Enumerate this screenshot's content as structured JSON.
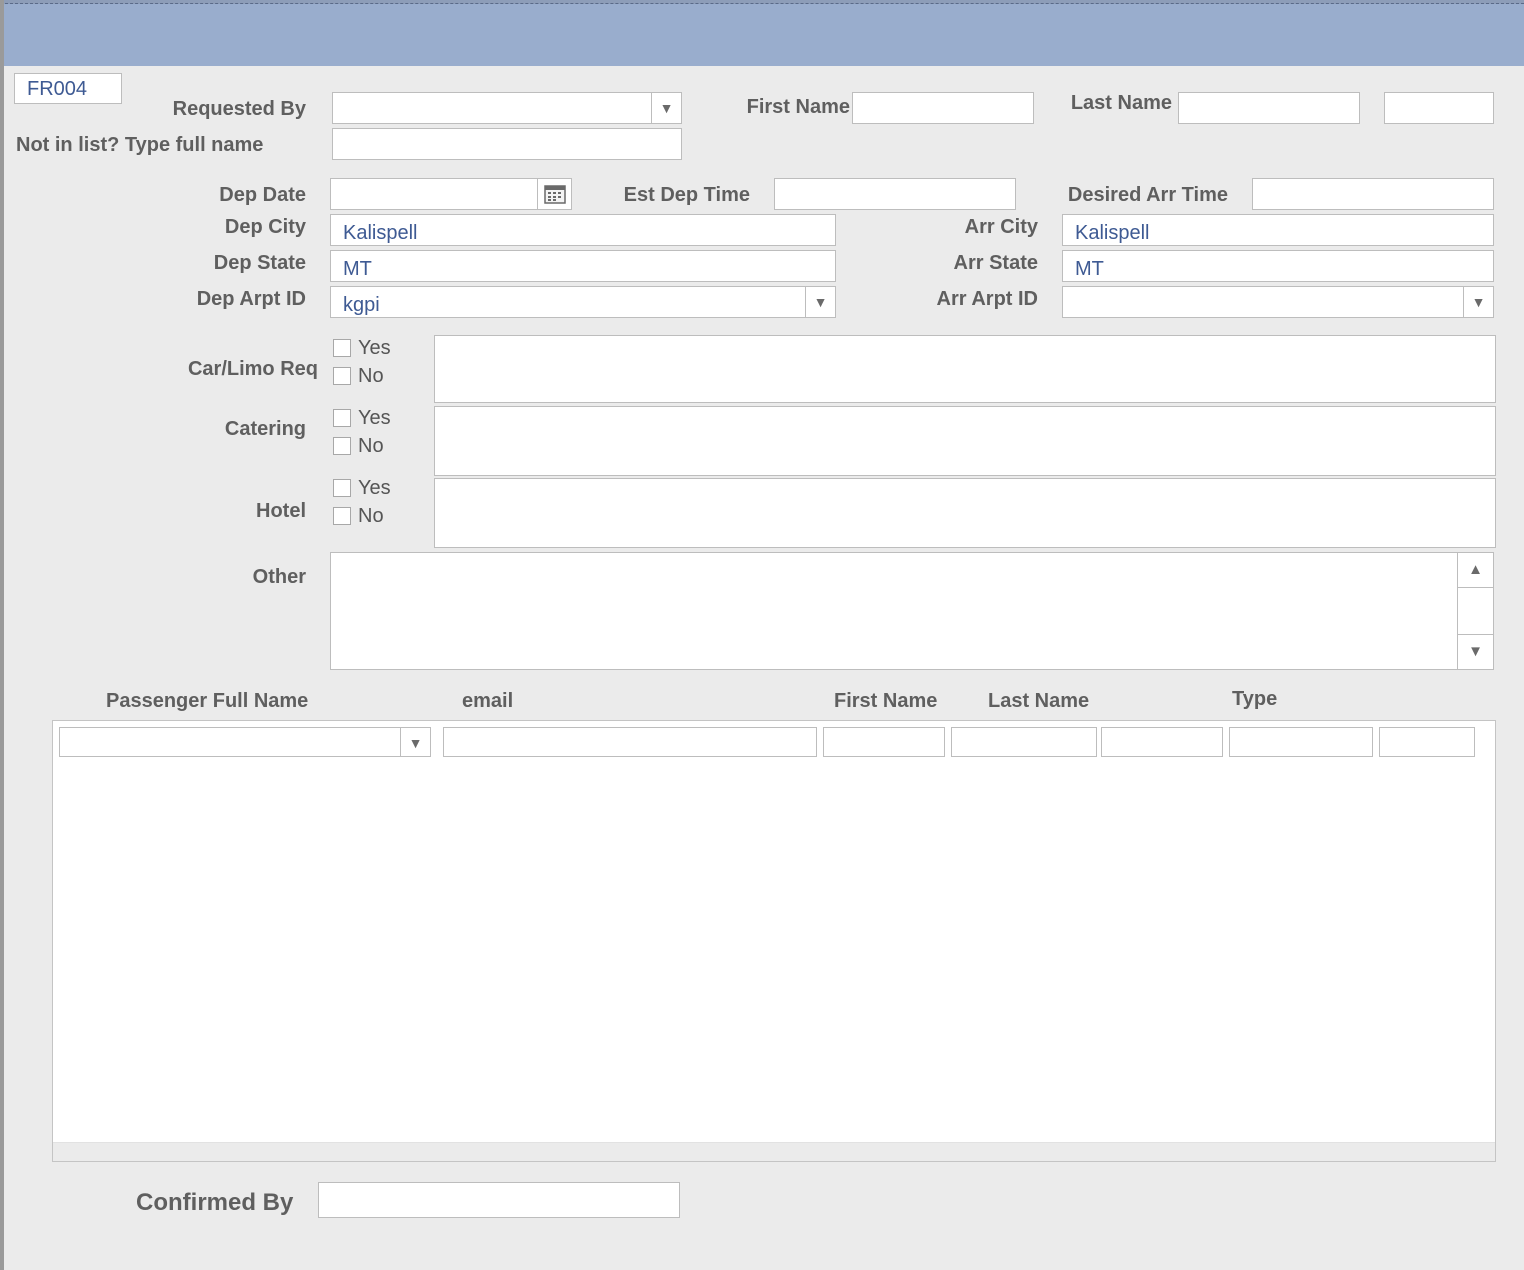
{
  "record_id": "FR004",
  "labels": {
    "requested_by": "Requested By",
    "first_name": "First Name",
    "last_name": "Last Name",
    "not_in_list": "Not in list? Type full name",
    "dep_date": "Dep Date",
    "est_dep_time": "Est Dep Time",
    "desired_arr_time": "Desired Arr Time",
    "dep_city": "Dep City",
    "arr_city": "Arr City",
    "dep_state": "Dep State",
    "arr_state": "Arr State",
    "dep_arpt_id": "Dep Arpt ID",
    "arr_arpt_id": "Arr Arpt ID",
    "car_limo": "Car/Limo Req",
    "catering": "Catering",
    "hotel": "Hotel",
    "other": "Other",
    "confirmed_by": "Confirmed By",
    "yes": "Yes",
    "no": "No"
  },
  "values": {
    "requested_by": "",
    "first_name": "",
    "last_name": "",
    "extra": "",
    "full_name": "",
    "dep_date": "",
    "est_dep_time": "",
    "desired_arr_time": "",
    "dep_city": "Kalispell",
    "arr_city": "Kalispell",
    "dep_state": "MT",
    "arr_state": "MT",
    "dep_arpt_id": "kgpi",
    "arr_arpt_id": "",
    "other": "",
    "confirmed_by": ""
  },
  "passengers": {
    "headers": [
      "Passenger Full Name",
      "email",
      "First Name",
      "Last Name",
      "Type"
    ]
  },
  "icons": {
    "dropdown": "▼",
    "scroll_up": "▲",
    "scroll_down": "▼",
    "calendar": "calendar-icon"
  }
}
